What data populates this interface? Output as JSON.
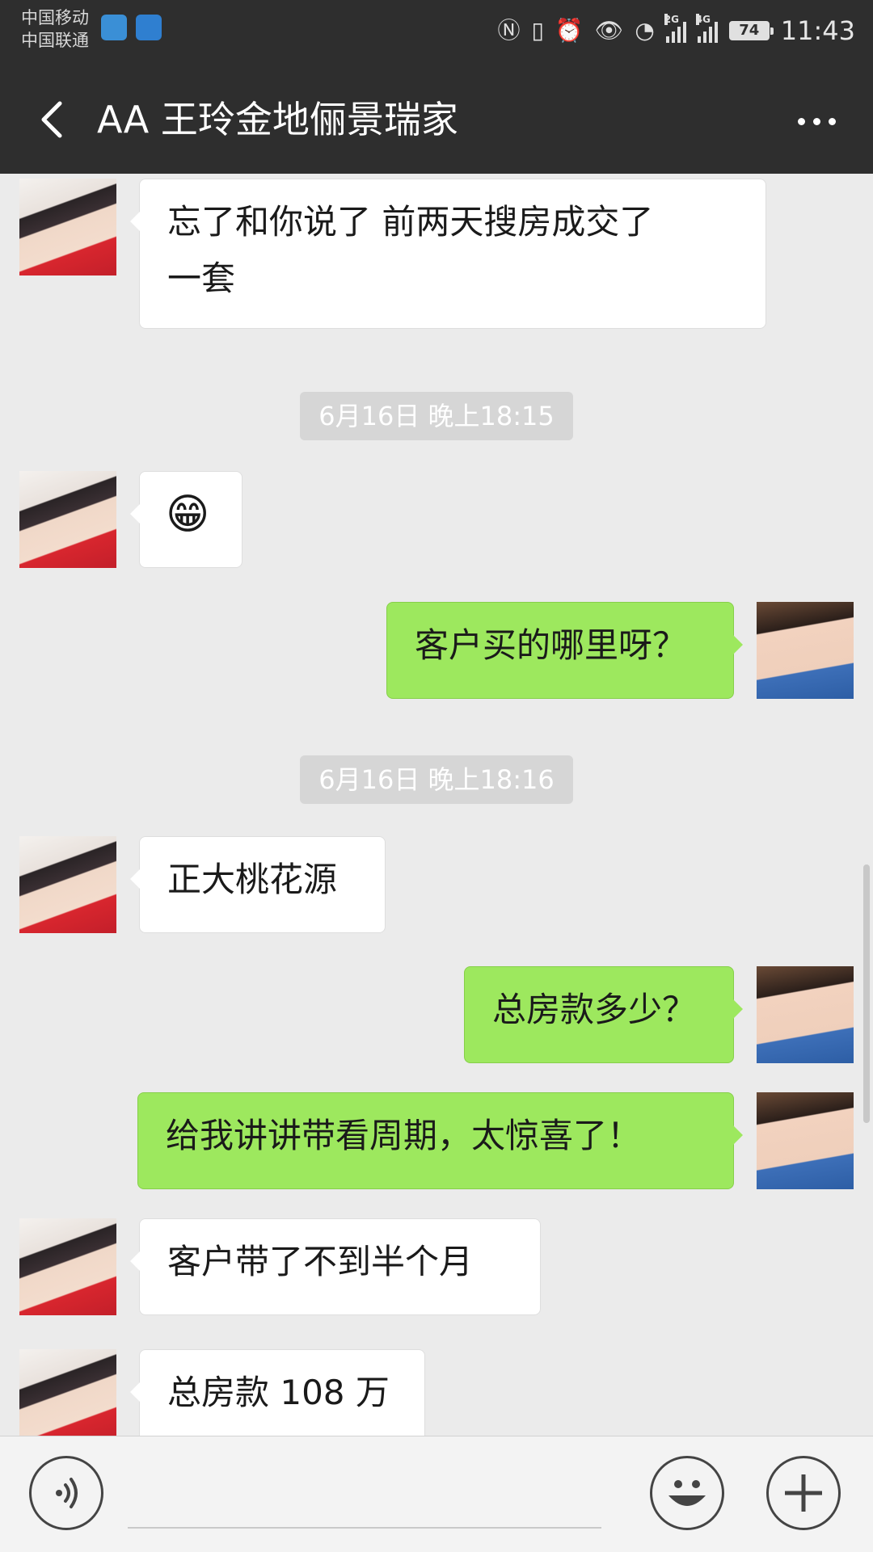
{
  "status_bar": {
    "carrier_1": "中国移动",
    "carrier_2": "中国联通",
    "network_2g": "2G",
    "network_4g": "4G",
    "battery": "74",
    "time": "11:43"
  },
  "header": {
    "title": "AA  王玲金地俪景瑞家"
  },
  "messages": [
    {
      "type": "text",
      "direction": "in",
      "lines": [
        "忘了和你说了   前两天搜房成交了",
        "一套"
      ]
    },
    {
      "type": "timestamp",
      "text": "6月16日 晚上18:15"
    },
    {
      "type": "emoji",
      "direction": "in",
      "text": "😁"
    },
    {
      "type": "text",
      "direction": "out",
      "text": "客户买的哪里呀？"
    },
    {
      "type": "timestamp",
      "text": "6月16日 晚上18:16"
    },
    {
      "type": "text",
      "direction": "in",
      "text": "正大桃花源"
    },
    {
      "type": "text",
      "direction": "out",
      "text": "总房款多少？"
    },
    {
      "type": "text",
      "direction": "out",
      "text": "给我讲讲带看周期，太惊喜了！"
    },
    {
      "type": "text",
      "direction": "in",
      "text": "客户带了不到半个月"
    },
    {
      "type": "text",
      "direction": "in",
      "text": "总房款 108 万"
    }
  ],
  "colors": {
    "header_bg": "#2e2e2e",
    "chat_bg": "#ebebeb",
    "outgoing_bubble": "#9de85e",
    "incoming_bubble": "#ffffff"
  }
}
